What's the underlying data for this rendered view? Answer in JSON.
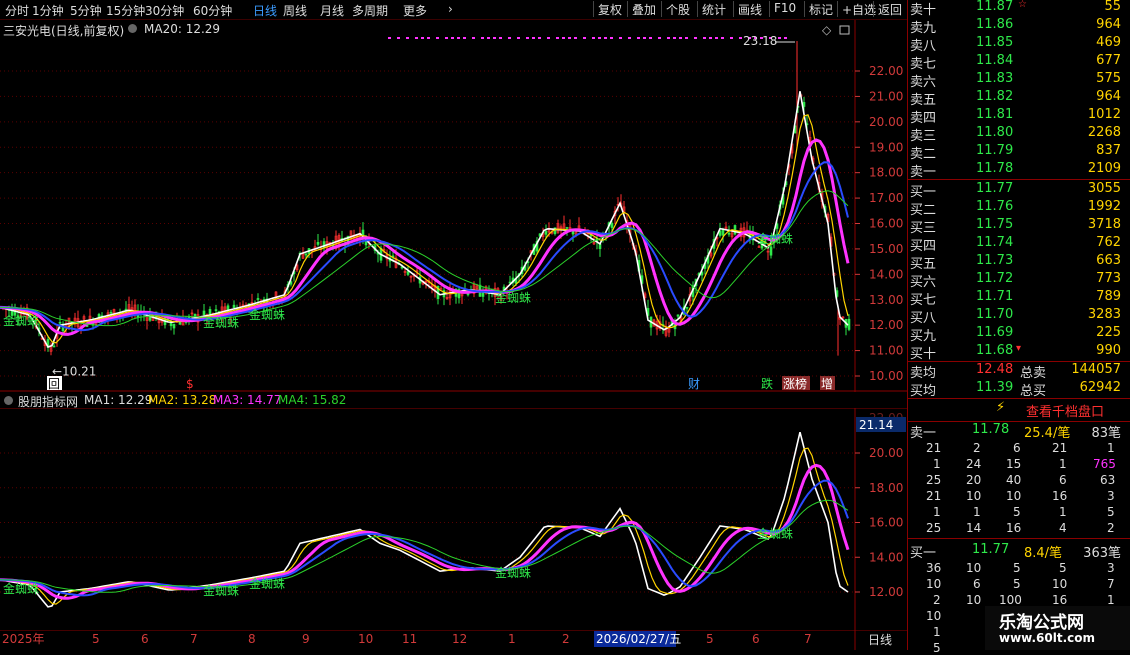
{
  "menu": {
    "left": [
      "分时",
      "1分钟",
      "5分钟",
      "15分钟",
      "30分钟",
      "60分钟",
      "日线",
      "周线",
      "月线",
      "多周期",
      "更多"
    ],
    "active": "日线",
    "right": [
      "复权",
      "叠加",
      "个股",
      "统计",
      "画线",
      "F10",
      "标记",
      "+自选",
      "返回"
    ]
  },
  "main_chart": {
    "header_title": "三安光电(日线,前复权)",
    "header_ma": "MA20: 12.29",
    "y_ticks": [
      "22.00",
      "21.00",
      "20.00",
      "19.00",
      "18.00",
      "17.00",
      "16.00",
      "15.00",
      "14.00",
      "13.00",
      "12.00",
      "11.00",
      "10.00"
    ],
    "high_label": "23.18",
    "low_label": "10.21",
    "signal_label": "金蜘蛛",
    "markers": [
      "回",
      "$",
      "财",
      "跌",
      "涨榜",
      "增"
    ]
  },
  "indicator_chart": {
    "header_title": "股朋指标网",
    "ma1": "MA1: 12.29",
    "ma2": "MA2: 13.28",
    "ma3": "MA3: 14.77",
    "ma4": "MA4: 15.82",
    "y_ticks": [
      "20.00",
      "18.00",
      "16.00",
      "14.00",
      "12.00"
    ],
    "current_value": "21.14",
    "signal_label": "金蜘蛛"
  },
  "x_axis": {
    "labels": [
      "2025年",
      "5",
      "6",
      "7",
      "8",
      "9",
      "10",
      "11",
      "12",
      "1",
      "2",
      "2026/02/27/五",
      "5",
      "6",
      "7"
    ],
    "period": "日线"
  },
  "order_book": {
    "sell": [
      {
        "name": "卖十",
        "price": "11.87",
        "vol": "55"
      },
      {
        "name": "卖九",
        "price": "11.86",
        "vol": "964"
      },
      {
        "name": "卖八",
        "price": "11.85",
        "vol": "469"
      },
      {
        "name": "卖七",
        "price": "11.84",
        "vol": "677"
      },
      {
        "name": "卖六",
        "price": "11.83",
        "vol": "575"
      },
      {
        "name": "卖五",
        "price": "11.82",
        "vol": "964"
      },
      {
        "name": "卖四",
        "price": "11.81",
        "vol": "1012"
      },
      {
        "name": "卖三",
        "price": "11.80",
        "vol": "2268"
      },
      {
        "name": "卖二",
        "price": "11.79",
        "vol": "837"
      },
      {
        "name": "卖一",
        "price": "11.78",
        "vol": "2109"
      }
    ],
    "buy": [
      {
        "name": "买一",
        "price": "11.77",
        "vol": "3055"
      },
      {
        "name": "买二",
        "price": "11.76",
        "vol": "1992"
      },
      {
        "name": "买三",
        "price": "11.75",
        "vol": "3718"
      },
      {
        "name": "买四",
        "price": "11.74",
        "vol": "762"
      },
      {
        "name": "买五",
        "price": "11.73",
        "vol": "663"
      },
      {
        "name": "买六",
        "price": "11.72",
        "vol": "773"
      },
      {
        "name": "买七",
        "price": "11.71",
        "vol": "789"
      },
      {
        "name": "买八",
        "price": "11.70",
        "vol": "3283"
      },
      {
        "name": "买九",
        "price": "11.69",
        "vol": "225"
      },
      {
        "name": "买十",
        "price": "11.68",
        "vol": "990"
      }
    ],
    "avg_sell_label": "卖均",
    "avg_sell": "12.48",
    "total_sell_label": "总卖",
    "total_sell": "144057",
    "avg_buy_label": "买均",
    "avg_buy": "11.39",
    "total_buy_label": "总买",
    "total_buy": "62942",
    "view_button": "查看千档盘口",
    "sell1": {
      "name": "卖一",
      "price": "11.78",
      "per": "25.4/笔",
      "count": "83笔",
      "rows": [
        [
          "21",
          "2",
          "6",
          "21",
          "1"
        ],
        [
          "1",
          "24",
          "15",
          "1",
          "765"
        ],
        [
          "25",
          "20",
          "40",
          "6",
          "63"
        ],
        [
          "21",
          "10",
          "10",
          "16",
          "3"
        ],
        [
          "1",
          "1",
          "5",
          "1",
          "5"
        ],
        [
          "25",
          "14",
          "16",
          "4",
          "2"
        ]
      ]
    },
    "buy1": {
      "name": "买一",
      "price": "11.77",
      "per": "8.4/笔",
      "count": "363笔",
      "rows": [
        [
          "36",
          "10",
          "5",
          "5",
          "3"
        ],
        [
          "10",
          "6",
          "5",
          "10",
          "7"
        ],
        [
          "2",
          "10",
          "100",
          "16",
          "1"
        ],
        [
          "10",
          "",
          "",
          "",
          ""
        ],
        [
          "1",
          "",
          "",
          "",
          ""
        ],
        [
          "5",
          "",
          "",
          "",
          ""
        ]
      ]
    }
  },
  "watermark": {
    "title": "乐淘公式网",
    "url": "www.60lt.com"
  },
  "colors": {
    "up": "#ff3030",
    "down": "#2ee84a",
    "grid": "#5a0000",
    "signal": "#2ee84a",
    "ma_white": "#ffffff",
    "ma_yellow": "#ffd400",
    "ma_magenta": "#ff33ff",
    "ma_blue": "#2a4bff",
    "ma_green": "#2bd12b"
  }
}
